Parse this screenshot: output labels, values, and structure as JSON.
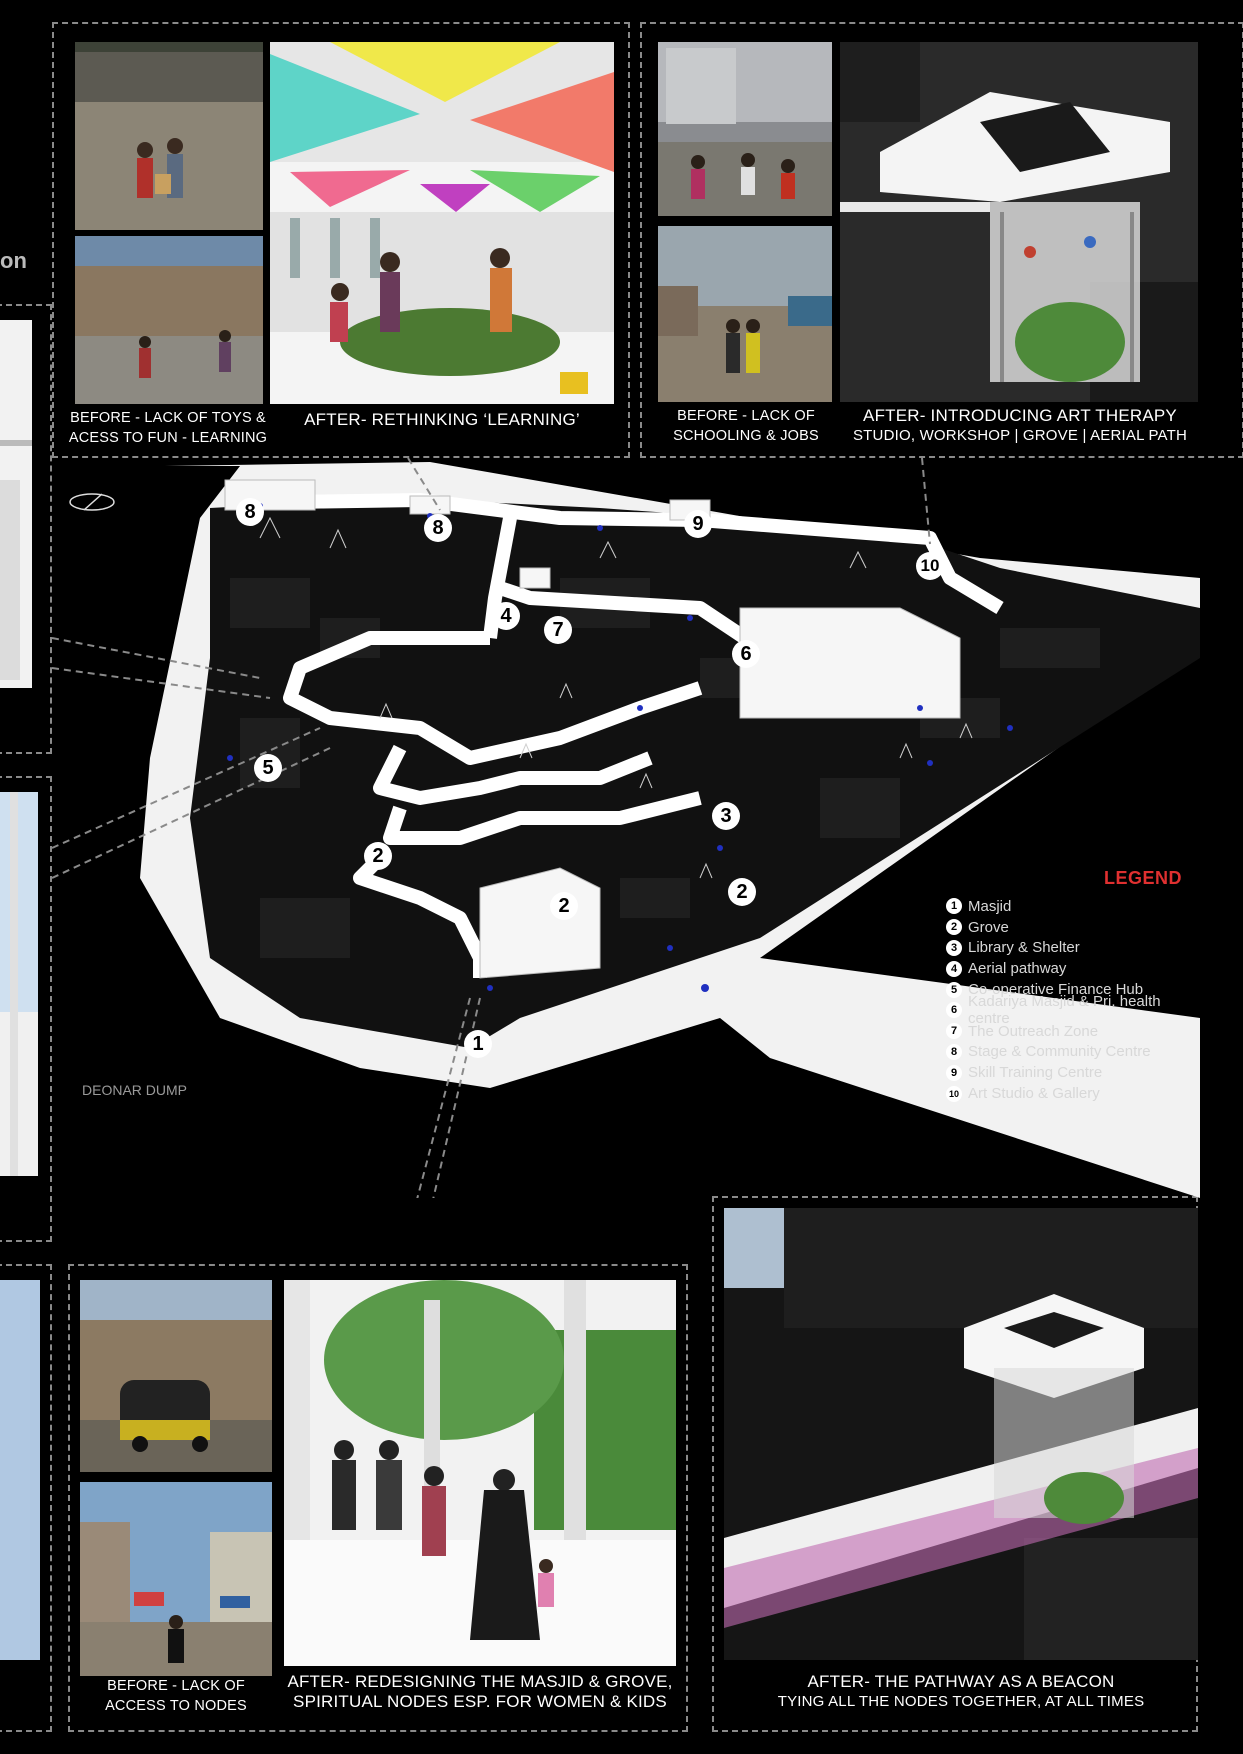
{
  "captions": {
    "before_toys": [
      "BEFORE - LACK OF TOYS &",
      "ACESS TO FUN - LEARNING"
    ],
    "after_learning": "AFTER- RETHINKING ‘LEARNING’",
    "before_schooling": [
      "BEFORE - LACK OF",
      "SCHOOLING & JOBS"
    ],
    "after_art": [
      "AFTER- INTRODUCING ART THERAPY",
      "STUDIO, WORKSHOP | GROVE | AERIAL PATH"
    ],
    "before_nodes": [
      "BEFORE - LACK OF",
      "ACCESS TO NODES"
    ],
    "after_masjid": [
      "AFTER- REDESIGNING THE MASJID & GROVE,",
      "SPIRITUAL NODES ESP. FOR WOMEN & KIDS"
    ],
    "after_beacon": [
      "AFTER- THE PATHWAY AS A BEACON",
      "TYING ALL THE NODES TOGETHER, AT ALL TIMES"
    ]
  },
  "edge_fragment": "on",
  "map_label": "DEONAR DUMP",
  "legend": {
    "title": "LEGEND",
    "items": [
      {
        "num": "1",
        "label": "Masjid"
      },
      {
        "num": "2",
        "label": "Grove"
      },
      {
        "num": "3",
        "label": "Library & Shelter"
      },
      {
        "num": "4",
        "label": "Aerial pathway"
      },
      {
        "num": "5",
        "label": "Co-operative Finance Hub"
      },
      {
        "num": "6",
        "label": "Kadariya Masjid & Pri. health centre"
      },
      {
        "num": "7",
        "label": "The Outreach Zone"
      },
      {
        "num": "8",
        "label": "Stage & Community Centre"
      },
      {
        "num": "9",
        "label": "Skill Training Centre"
      },
      {
        "num": "10",
        "label": "Art Studio & Gallery"
      }
    ]
  },
  "markers": [
    "8",
    "8",
    "9",
    "10",
    "4",
    "7",
    "6",
    "5",
    "3",
    "2",
    "2",
    "2",
    "1"
  ],
  "colors": {
    "background": "#000000",
    "legend_title": "#e03030",
    "dash": "#8a8a8a",
    "path_blue": "#2030c0"
  }
}
